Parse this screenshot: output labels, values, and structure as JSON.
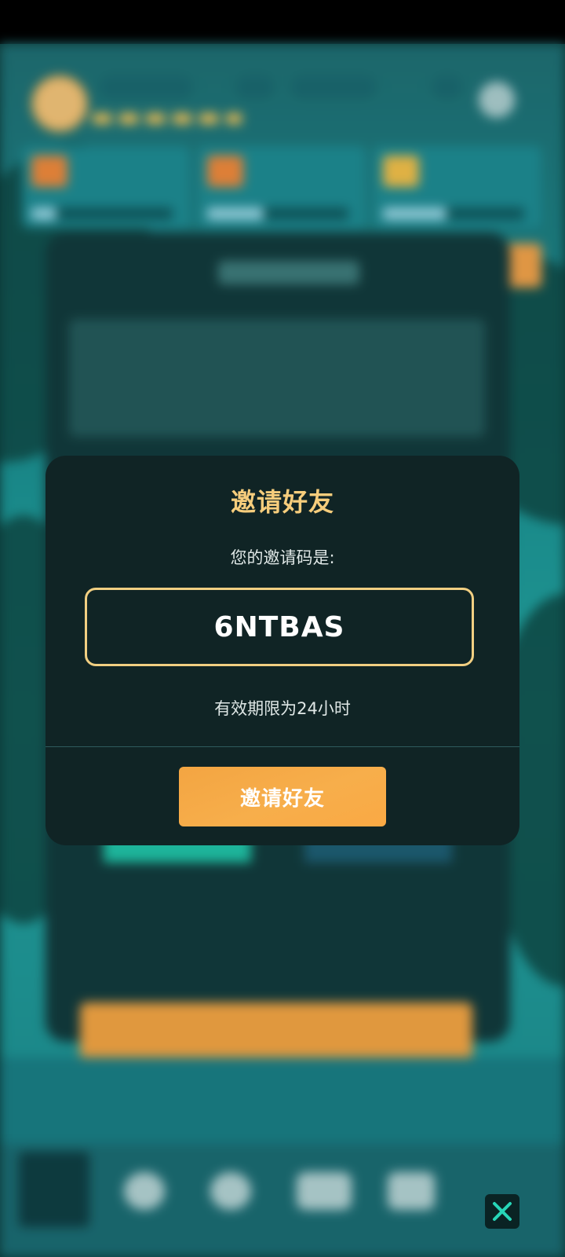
{
  "modal": {
    "title": "邀请好友",
    "subtitle": "您的邀请码是:",
    "invite_code": "6NTBAS",
    "expiry_text": "有效期限为24小时",
    "invite_button_label": "邀请好友"
  },
  "colors": {
    "accent": "#f6cd7c",
    "button": "#f5a745",
    "modal_bg": "#102425"
  },
  "icons": {
    "close": "close-icon"
  }
}
